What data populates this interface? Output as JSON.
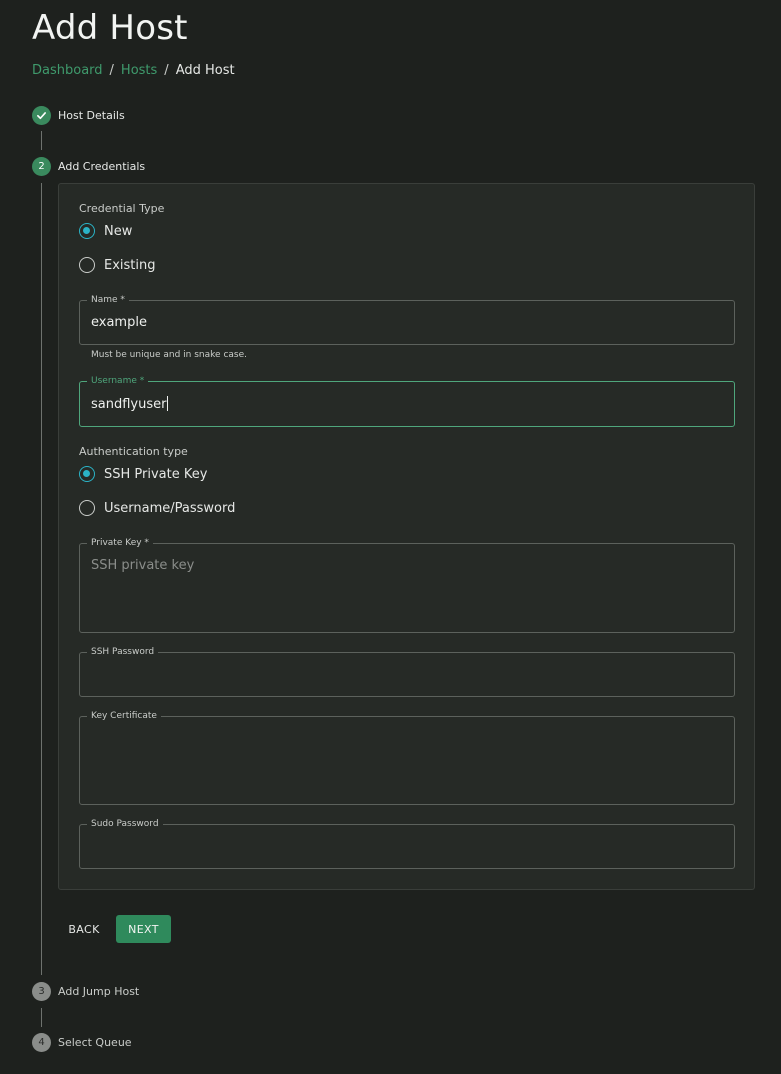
{
  "page_title": "Add Host",
  "breadcrumb": {
    "items": [
      "Dashboard",
      "Hosts"
    ],
    "current": "Add Host",
    "separator": "/"
  },
  "steps": [
    {
      "number": "1",
      "label": "Host Details",
      "status": "completed"
    },
    {
      "number": "2",
      "label": "Add Credentials",
      "status": "active"
    },
    {
      "number": "3",
      "label": "Add Jump Host",
      "status": "pending"
    },
    {
      "number": "4",
      "label": "Select Queue",
      "status": "pending"
    }
  ],
  "form": {
    "credential_type": {
      "label": "Credential Type",
      "options": [
        "New",
        "Existing"
      ],
      "selected": "New"
    },
    "name": {
      "label": "Name *",
      "value": "example",
      "helper": "Must be unique and in snake case."
    },
    "username": {
      "label": "Username *",
      "value": "sandflyuser"
    },
    "auth_type": {
      "label": "Authentication type",
      "options": [
        "SSH Private Key",
        "Username/Password"
      ],
      "selected": "SSH Private Key"
    },
    "private_key": {
      "label": "Private Key *",
      "placeholder": "SSH private key",
      "value": ""
    },
    "ssh_password": {
      "label": "SSH Password",
      "value": ""
    },
    "key_certificate": {
      "label": "Key Certificate",
      "value": ""
    },
    "sudo_password": {
      "label": "Sudo Password",
      "value": ""
    }
  },
  "buttons": {
    "back": "BACK",
    "next": "NEXT"
  },
  "colors": {
    "accent": "#2bb3c6",
    "primary": "#2f8a5c",
    "link": "#3f9a6c",
    "background": "#1e211e"
  }
}
